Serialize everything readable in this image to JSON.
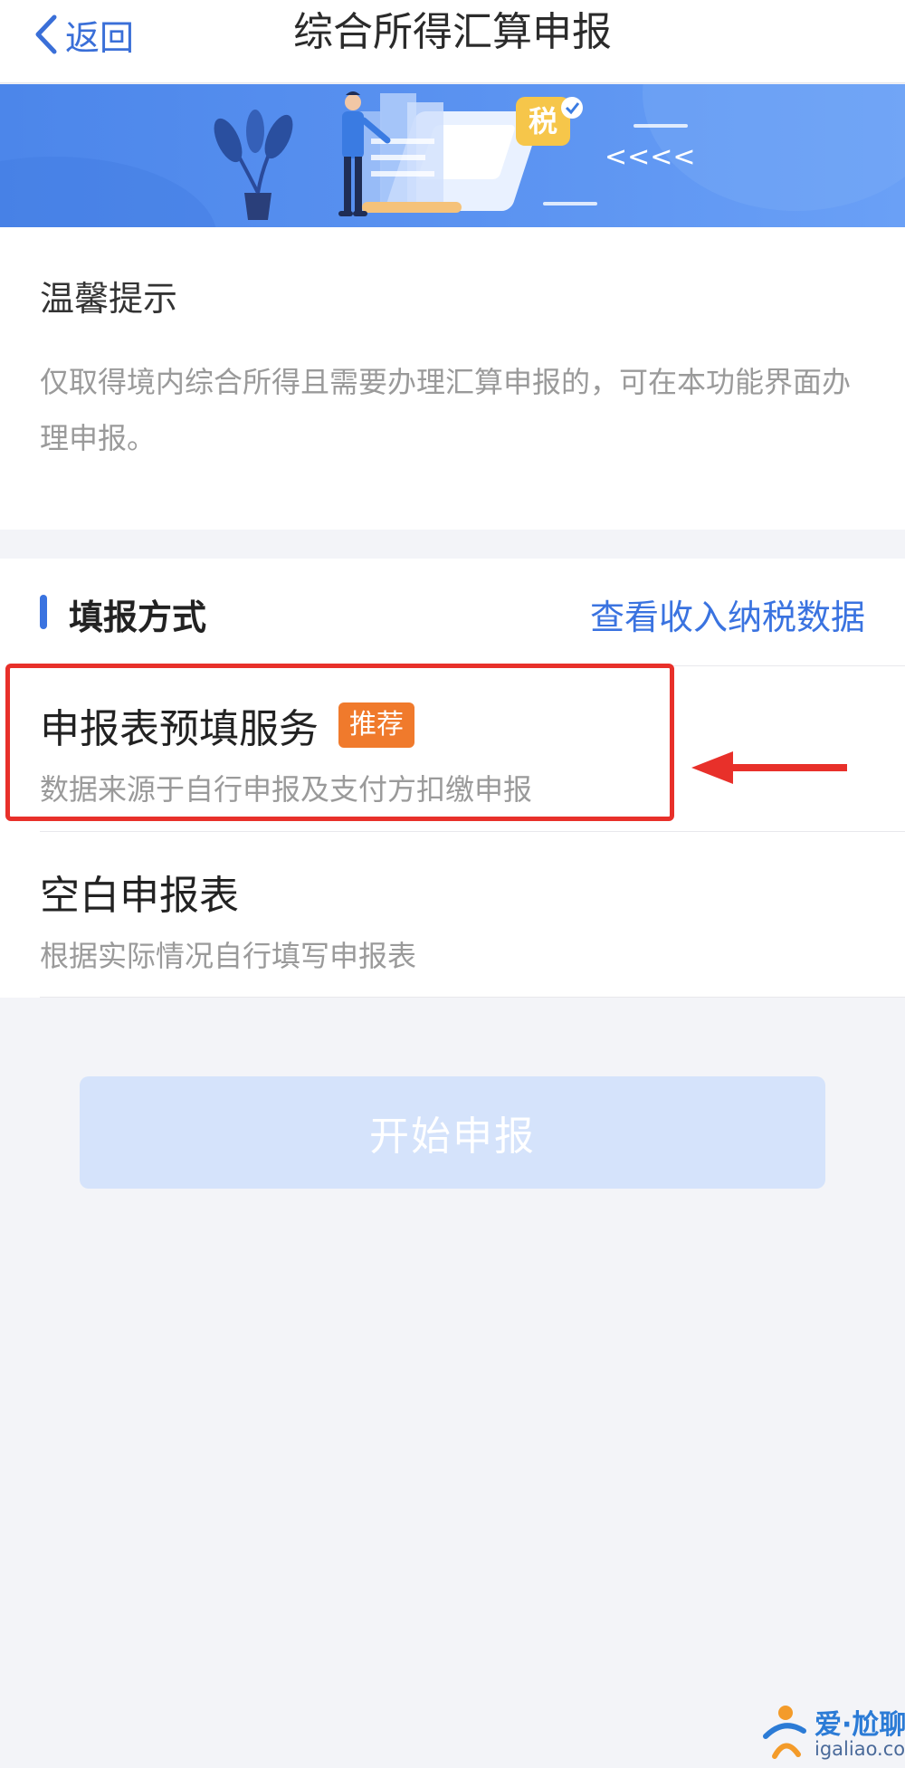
{
  "nav": {
    "back_label": "返回",
    "title": "综合所得汇算申报"
  },
  "banner": {
    "tax_badge": "税",
    "arrows": "<<<<"
  },
  "tips": {
    "title": "温馨提示",
    "body": "仅取得境内综合所得且需要办理汇算申报的，可在本功能界面办理申报。"
  },
  "methods": {
    "section_title": "填报方式",
    "link": "查看收入纳税数据",
    "options": [
      {
        "title": "申报表预填服务",
        "tag": "推荐",
        "desc": "数据来源于自行申报及支付方扣缴申报"
      },
      {
        "title": "空白申报表",
        "desc": "根据实际情况自行填写申报表"
      }
    ]
  },
  "start_button": {
    "label": "开始申报"
  },
  "watermark": {
    "brand": "爱·尬聊",
    "domain": "igaliao.com"
  },
  "colors": {
    "accent": "#3a73e0",
    "tag": "#f07a2c",
    "highlight": "#e8302a",
    "button_disabled": "#d5e3fb"
  }
}
